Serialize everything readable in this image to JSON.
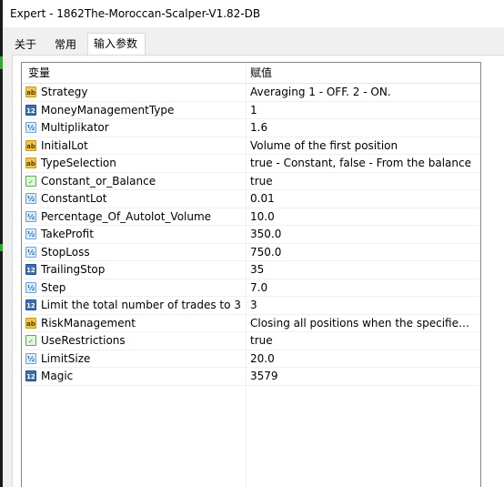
{
  "window": {
    "title": "Expert - 1862The-Moroccan-Scalper-V1.82-DB"
  },
  "tabs": [
    {
      "label": "关于",
      "active": false
    },
    {
      "label": "常用",
      "active": false
    },
    {
      "label": "输入参数",
      "active": true
    }
  ],
  "grid": {
    "columns": {
      "variable": "变量",
      "value": "赋值"
    },
    "rows": [
      {
        "icon": "ab",
        "icon_label": "ab",
        "name": "Strategy",
        "value": "Averaging 1 - OFF. 2 - ON."
      },
      {
        "icon": "n123",
        "icon_label": "123",
        "name": "MoneyManagementType",
        "value": "1"
      },
      {
        "icon": "half",
        "icon_label": "½",
        "name": "Multiplikator",
        "value": "1.6"
      },
      {
        "icon": "ab",
        "icon_label": "ab",
        "name": "InitialLot",
        "value": "Volume of the first position"
      },
      {
        "icon": "ab",
        "icon_label": "ab",
        "name": "TypeSelection",
        "value": "true - Constant, false - From the balance"
      },
      {
        "icon": "bool",
        "icon_label": "✓",
        "name": "Constant_or_Balance",
        "value": "true"
      },
      {
        "icon": "half",
        "icon_label": "½",
        "name": "ConstantLot",
        "value": "0.01"
      },
      {
        "icon": "half",
        "icon_label": "½",
        "name": "Percentage_Of_Autolot_Volume",
        "value": "10.0"
      },
      {
        "icon": "half",
        "icon_label": "½",
        "name": "TakeProfit",
        "value": "350.0"
      },
      {
        "icon": "half",
        "icon_label": "½",
        "name": "StopLoss",
        "value": "750.0"
      },
      {
        "icon": "n123",
        "icon_label": "123",
        "name": "TrailingStop",
        "value": "35"
      },
      {
        "icon": "half",
        "icon_label": "½",
        "name": "Step",
        "value": "7.0"
      },
      {
        "icon": "n123",
        "icon_label": "123",
        "name": "Limit the total number of trades to 3",
        "value": "3"
      },
      {
        "icon": "ab",
        "icon_label": "ab",
        "name": "RiskManagement",
        "value": "Closing all positions when the specified lev..."
      },
      {
        "icon": "bool",
        "icon_label": "✓",
        "name": "UseRestrictions",
        "value": "true"
      },
      {
        "icon": "half",
        "icon_label": "½",
        "name": "LimitSize",
        "value": "20.0"
      },
      {
        "icon": "n123",
        "icon_label": "123",
        "name": "Magic",
        "value": "3579"
      }
    ]
  }
}
